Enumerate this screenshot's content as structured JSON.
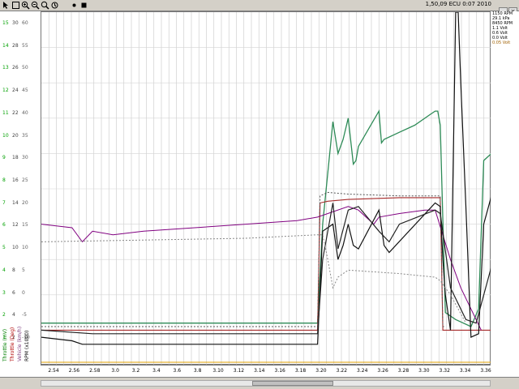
{
  "toolbar": {
    "buttons": [
      "cursor-icon",
      "zoom-box-icon",
      "zoom-in-icon",
      "zoom-out-icon",
      "zoom-fit-icon",
      "undo-zoom-icon",
      "marker-icon",
      "stop-icon"
    ],
    "title_text": "1,50,09 ECU  0:07 2010"
  },
  "left_axes": {
    "columns": [
      {
        "color": "#00a000",
        "ticks": [
          "15",
          "14",
          "13",
          "12",
          "11",
          "10",
          "9",
          "8",
          "7",
          "6",
          "5",
          "4",
          "3",
          "2",
          "1"
        ]
      },
      {
        "color": "#404040",
        "ticks": [
          "30",
          "28",
          "26",
          "24",
          "22",
          "20",
          "18",
          "16",
          "14",
          "12",
          "10",
          "8",
          "6",
          "4",
          "2"
        ]
      },
      {
        "color": "#606060",
        "ticks": [
          "60",
          "55",
          "50",
          "45",
          "40",
          "35",
          "30",
          "25",
          "20",
          "15",
          "10",
          "5",
          "0",
          "-5",
          "-10"
        ]
      }
    ],
    "vertical_labels": [
      {
        "text": "Throttle (mV)",
        "color": "#008000"
      },
      {
        "text": "Throttle (Deg)",
        "color": "#b00000"
      },
      {
        "text": "Vehicle (km/h)",
        "color": "#804080"
      },
      {
        "text": "RPM (x1000)",
        "color": "#000000"
      }
    ]
  },
  "legend": {
    "items": [
      {
        "text": "1150 RPM",
        "color": "#000000"
      },
      {
        "text": "29.1 kPa",
        "color": "#000000"
      },
      {
        "text": "8450 RPM",
        "color": "#000000"
      },
      {
        "text": "1.1 Volt",
        "color": "#000000"
      },
      {
        "text": "0.6 Volt",
        "color": "#000000"
      },
      {
        "text": "0.0 Volt",
        "color": "#000000"
      },
      {
        "text": "0.05 Volt",
        "color": "#a06000"
      }
    ]
  },
  "chart_data": {
    "type": "line",
    "x_tick_labels": [
      "2.54",
      "2.56",
      "2.58",
      "3.0",
      "3.2",
      "3.4",
      "3.6",
      "3.8",
      "3.10",
      "3.12",
      "3.14",
      "3.16",
      "3.18",
      "3.20",
      "3.22",
      "3.24",
      "3.26",
      "3.28",
      "3.30",
      "3.32",
      "3.34",
      "3.36"
    ],
    "xlim": [
      2.5,
      3.38
    ],
    "ylim": [
      0,
      100
    ],
    "grid": true,
    "series": [
      {
        "color": "#2e8b57",
        "style": "solid",
        "width": 1.3,
        "x": [
          2.5,
          2.8,
          3.04,
          3.05,
          3.07,
          3.08,
          3.09,
          3.1,
          3.11,
          3.115,
          3.12,
          3.14,
          3.16,
          3.165,
          3.17,
          3.2,
          3.23,
          3.26,
          3.27,
          3.275,
          3.28,
          3.29,
          3.31,
          3.34,
          3.355,
          3.365,
          3.38
        ],
        "y": [
          12,
          12,
          12,
          40,
          69,
          60,
          64,
          70,
          57,
          58,
          62,
          67,
          72,
          63,
          64,
          66,
          68,
          71,
          72,
          72,
          68,
          15,
          13,
          11,
          16,
          58,
          60
        ]
      },
      {
        "color": "#a52a2a",
        "style": "solid",
        "width": 1.1,
        "x": [
          2.5,
          3.04,
          3.045,
          3.06,
          3.1,
          3.2,
          3.26,
          3.28,
          3.285,
          3.29,
          3.34,
          3.38
        ],
        "y": [
          10,
          10,
          46,
          46.5,
          47,
          47.5,
          47.5,
          47.5,
          10,
          10,
          10,
          10
        ]
      },
      {
        "color": "#555555",
        "style": "dotted",
        "width": 1,
        "x": [
          2.5,
          3.04,
          3.045,
          3.06,
          3.1,
          3.2,
          3.27,
          3.28,
          3.285,
          3.29
        ],
        "y": [
          11,
          11,
          48,
          49,
          48.5,
          48,
          48,
          48,
          11,
          11
        ]
      },
      {
        "color": "#800080",
        "style": "solid",
        "width": 1,
        "x": [
          2.5,
          2.56,
          2.58,
          2.6,
          2.64,
          2.7,
          2.8,
          2.9,
          3.0,
          3.04,
          3.1,
          3.12,
          3.15,
          3.16,
          3.2,
          3.25,
          3.27,
          3.3,
          3.32,
          3.36
        ],
        "y": [
          40,
          39,
          35,
          38,
          37,
          38,
          39,
          40,
          41,
          42,
          45,
          44,
          40,
          42,
          43,
          44,
          44,
          30,
          22,
          10
        ]
      },
      {
        "color": "#111111",
        "style": "solid",
        "width": 1.2,
        "x": [
          2.5,
          2.56,
          2.58,
          2.6,
          3.04,
          3.05,
          3.07,
          3.08,
          3.09,
          3.1,
          3.11,
          3.12,
          3.16,
          3.17,
          3.18,
          3.27,
          3.28,
          3.285,
          3.29,
          3.3,
          3.31,
          3.315,
          3.32,
          3.33,
          3.34,
          3.355,
          3.365,
          3.38
        ],
        "y": [
          8,
          7,
          6,
          6,
          6,
          38,
          40,
          30,
          34,
          40,
          34,
          33,
          44,
          34,
          32,
          46,
          45,
          30,
          20,
          10,
          100,
          110,
          80,
          45,
          8,
          9,
          40,
          48
        ]
      },
      {
        "color": "#222222",
        "style": "solid",
        "width": 1.2,
        "x": [
          2.5,
          2.6,
          3.04,
          3.05,
          3.07,
          3.08,
          3.1,
          3.12,
          3.16,
          3.18,
          3.2,
          3.27,
          3.28,
          3.3,
          3.33,
          3.35,
          3.38
        ],
        "y": [
          10,
          9,
          9,
          30,
          46,
          33,
          44,
          45,
          38,
          35,
          40,
          44,
          43,
          22,
          13,
          12,
          28
        ]
      },
      {
        "color": "#888888",
        "style": "dotted",
        "width": 1,
        "x": [
          2.5,
          2.9,
          3.04,
          3.05,
          3.06,
          3.07,
          3.08,
          3.1,
          3.2,
          3.27,
          3.28,
          3.3,
          3.33
        ],
        "y": [
          35,
          36,
          37,
          37,
          30,
          22,
          25,
          27,
          26,
          25,
          24,
          20,
          12
        ]
      }
    ]
  }
}
